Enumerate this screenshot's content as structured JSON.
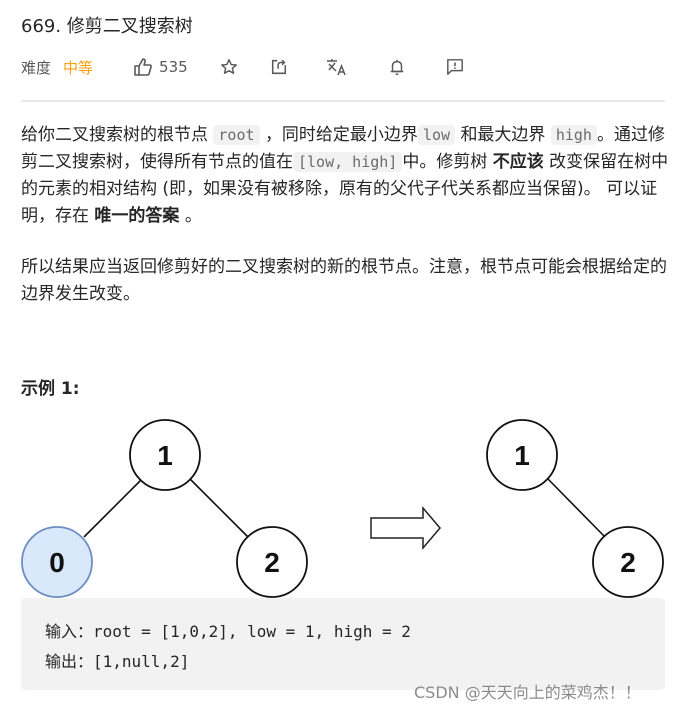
{
  "problem": {
    "number_title": "669. 修剪二叉搜索树",
    "difficulty_label": "难度",
    "difficulty": "中等",
    "likes": "535"
  },
  "toolbar_icons": [
    "thumbs-up-icon",
    "star-icon",
    "share-icon",
    "translate-icon",
    "bell-icon",
    "feedback-icon"
  ],
  "colors": {
    "difficulty": "#ffa116",
    "highlight_node_fill": "#dae8fc",
    "highlight_node_stroke": "#6c8ebf"
  },
  "description": {
    "p1": {
      "t1": "给你二叉搜索树的根节点",
      "c1": "root",
      "t2": "，同时给定最小边界",
      "c2": "low",
      "t3": "和最大边界",
      "c3": "high",
      "t4": "。通过修剪二叉搜索树，使得所有节点的值在",
      "c4": "[low, high]",
      "t5": "中。修剪树",
      "b1": "不应该",
      "t6": "改变保留在树中的元素的相对结构 (即，如果没有被移除，原有的父代子代关系都应当保留)。 可以证明，存在",
      "b2": "唯一的答案",
      "t7": "。"
    },
    "p2": "所以结果应当返回修剪好的二叉搜索树的新的根节点。注意，根节点可能会根据给定的边界发生改变。"
  },
  "example": {
    "title": "示例 1:",
    "input_tree": [
      {
        "id": "n1",
        "value": "1",
        "highlight": false
      },
      {
        "id": "n0",
        "value": "0",
        "highlight": true
      },
      {
        "id": "n2",
        "value": "2",
        "highlight": false
      }
    ],
    "output_tree": [
      {
        "id": "m1",
        "value": "1",
        "highlight": false
      },
      {
        "id": "m2",
        "value": "2",
        "highlight": false
      }
    ],
    "input_line": "输入：root = [1,0,2], low = 1, high = 2",
    "output_line": "输出：[1,null,2]"
  },
  "watermark": "CSDN @天天向上的菜鸡杰！！"
}
